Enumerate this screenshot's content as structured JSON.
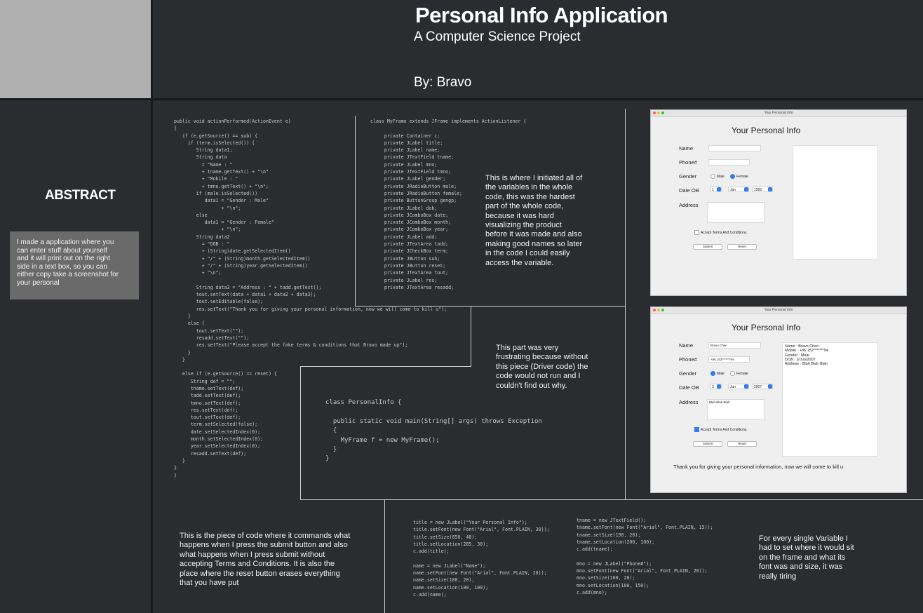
{
  "header": {
    "title": "Personal Info Application",
    "subtitle": "A Computer Science Project",
    "author": "By: Bravo"
  },
  "abstract": {
    "heading": "ABSTRACT",
    "text": "I made a application where you\ncan enter stuff about yourself\nand it will print out on the right\nside in a text box, so you can\neither copy take a screenshot for\nyour personal"
  },
  "code_action": "public void actionPerformed(ActionEvent e)\n{\n   if (e.getSource() == sub) {\n     if (term.isSelected()) {\n        String data1;\n        String data\n          = \"Name : \"\n          + tname.getText() + \"\\n\"\n          + \"Mobile : \"\n          + tmno.getText() + \"\\n\";\n        if (male.isSelected())\n           data1 = \"Gender : Male\"\n                 + \"\\n\";\n        else\n           data1 = \"Gender : Female\"\n                 + \"\\n\";\n        String data2\n          = \"DOB : \"\n          + (String)date.getSelectedItem()\n          + \"/\" + (String)month.getSelectedItem()\n          + \"/\" + (String)year.getSelectedItem()\n          + \"\\n\";\n\n        String data3 = \"Address : \" + tadd.getText();\n        tout.setText(data + data1 + data2 + data3);\n        tout.setEditable(false);\n        res.setText(\"Thank you for giving your personal information, now we will come to kill u\");\n     }\n     else {\n        tout.setText(\"\");\n        resadd.setText(\"\");\n        res.setText(\"Please accept the fake terms & conditions that Bravo made up\");\n     }\n   }\n\n   else if (e.getSource() == reset) {\n      String def = \"\";\n      tname.setText(def);\n      tadd.setText(def);\n      tmno.setText(def);\n      res.setText(def);\n      tout.setText(def);\n      term.setSelected(false);\n      date.setSelectedIndex(0);\n      month.setSelectedIndex(0);\n      year.setSelectedIndex(0);\n      resadd.setText(def);\n   }\n}\n}",
  "code_fields": "class MyFrame extends JFrame implements ActionListener {\n\n     private Container c;\n     private JLabel title;\n     private JLabel name;\n     private JTextField tname;\n     private JLabel mno;\n     private JTextField tmno;\n     private JLabel gender;\n     private JRadioButton male;\n     private JRadioButton female;\n     private ButtonGroup gengp;\n     private JLabel dob;\n     private JComboBox date;\n     private JComboBox month;\n     private JComboBox year;\n     private JLabel add;\n     private JTextArea tadd;\n     private JCheckBox term;\n     private JButton sub;\n     private JButton reset;\n     private JTextArea tout;\n     private JLabel res;\n     private JTextArea resadd;",
  "note_fields": "This is where I initiated all of\nthe variables in the whole\ncode, this was the hardest\npart of the whole code,\nbecause it was hard\nvisualizing the product\nbefore it was made and also\nmaking good names so later\nin the code I could easily\naccess the variable.",
  "note_driver": "This part was very\nfrustrating because without\nthis piece (Driver code) the\ncode would not run and I\ncouldn't find out why.",
  "code_driver": "class PersonalInfo {\n\n  public static void main(String[] args) throws Exception\n  {\n    MyFrame f = new MyFrame();\n  }\n}",
  "note_action": "This is the piece of code where it commands what\nhappens when I press the submit button and also\nwhat happens when I press submit without\naccepting Terms and Conditions. It is also the\nplace where the reset button erases everything\nthat you have put",
  "code_setup_left": "title = new JLabel(\"Your Personal Info\");\ntitle.setFont(new Font(\"Arial\", Font.PLAIN, 30));\ntitle.setSize(650, 40);\ntitle.setLocation(285, 30);\nc.add(title);\n\nname = new JLabel(\"Name\");\nname.setFont(new Font(\"Arial\", Font.PLAIN, 20));\nname.setSize(100, 20);\nname.setLocation(100, 100);\nc.add(name);",
  "code_setup_right": "tname = new JTextField();\ntname.setFont(new Font(\"Arial\", Font.PLAIN, 15));\ntname.setSize(190, 20);\ntname.setLocation(200, 100);\nc.add(tname);\n\nmno = new JLabel(\"Phone#\");\nmno.setFont(new Font(\"Arial\", Font.PLAIN, 20));\nmno.setSize(100, 20);\nmno.setLocation(100, 150);\nc.add(mno);",
  "note_setup": "For every single Variable I\nhad to set where it would sit\non the frame and what its\nfont was and size, it was\nreally tiring",
  "window1": {
    "titlebar": "Your Personal Info",
    "heading": "Your Personal Info",
    "name_label": "Name",
    "phone_label": "Phone#",
    "gender_label": "Gender",
    "male": "Male",
    "female": "Female",
    "dob_label": "Date OB",
    "day": "1",
    "month": "Jan",
    "year": "1995",
    "address_label": "Address",
    "terms": "Accept Terms And Conditions.",
    "submit": "Submit",
    "reset": "Reset"
  },
  "window2": {
    "titlebar": "Your Personal Info",
    "heading": "Your Personal Info",
    "name_label": "Name",
    "name_value": "Bravo Chen",
    "phone_label": "Phone#",
    "phone_value": "+86 152*******94",
    "gender_label": "Gender",
    "male": "Male",
    "female": "Female",
    "dob_label": "Date OB",
    "day": "3",
    "month": "Jun",
    "year": "2007",
    "address_label": "Address",
    "address_value": "Blah Blah Blah",
    "terms": "Accept Terms And Conditions.",
    "submit": "Submit",
    "reset": "Reset",
    "output": "Name : Bravo Chen\nMobile : +86 152*******94\nGender : Male\nDOB : 3/Jun/2007\nAddress : Blah Blah Blah",
    "result": "Thank you for giving your personal information, now we will come to kill u"
  },
  "colors": {
    "background": "#2b2c30",
    "sidebar_top": "#b0b0b0",
    "abstract_box": "#6a6a6a",
    "accent_blue": "#2f7cf6"
  }
}
